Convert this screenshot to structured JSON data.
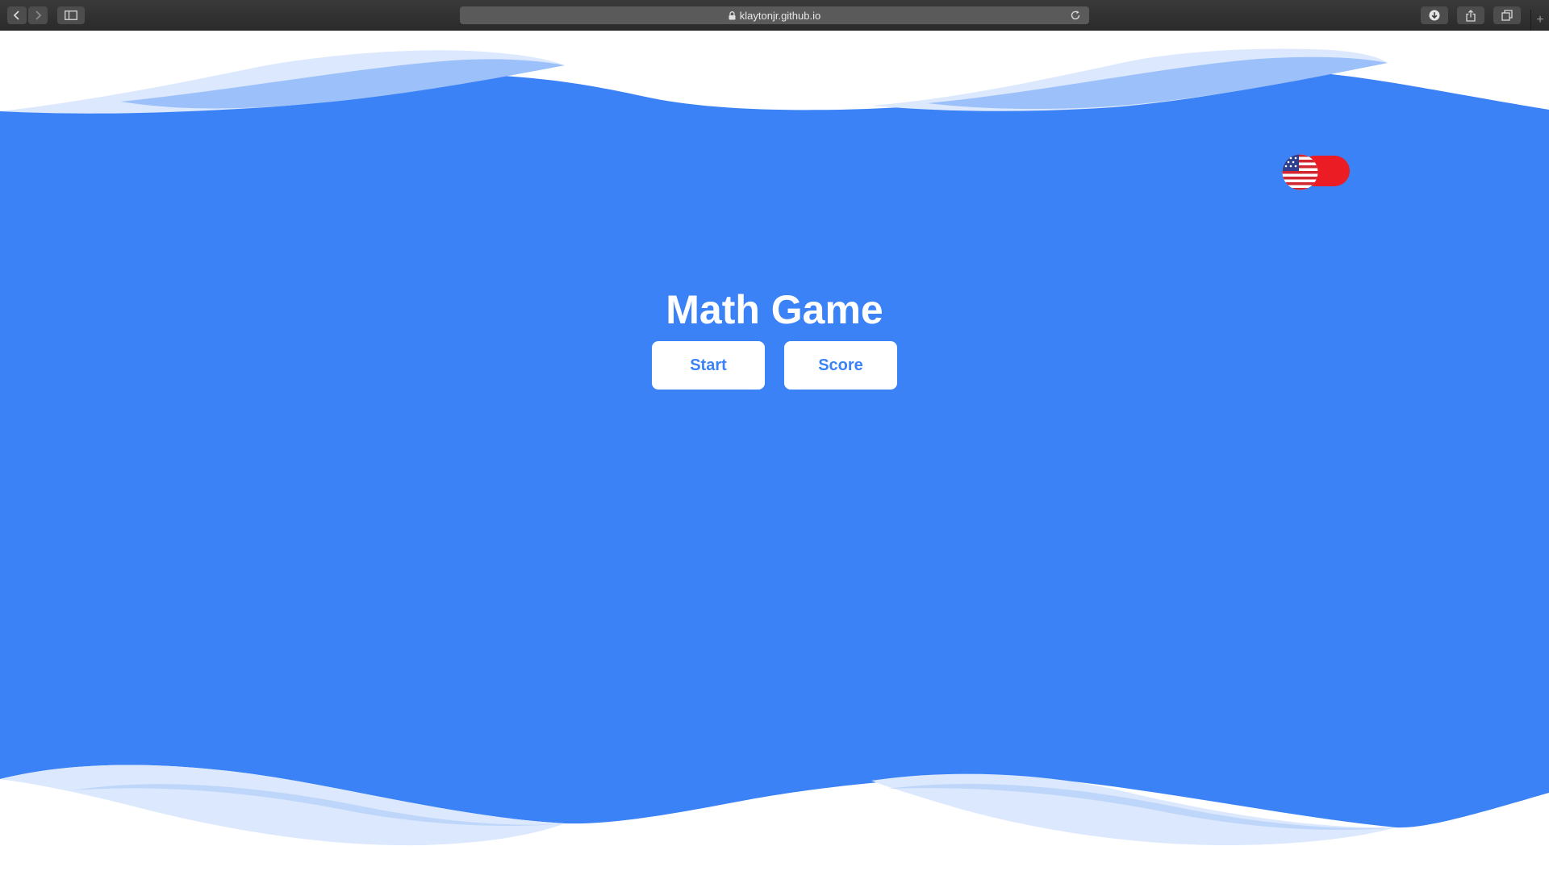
{
  "browser": {
    "url": "klaytonjr.github.io",
    "new_tab_symbol": "+",
    "icons": {
      "back": "chevron-left-icon",
      "forward": "chevron-right-icon",
      "sidebar": "sidebar-icon",
      "lock": "lock-icon",
      "reload": "reload-icon",
      "downloads": "download-icon",
      "share": "share-icon",
      "tabs": "tabs-overview-icon"
    }
  },
  "page": {
    "title": "Math Game",
    "buttons": {
      "start": "Start",
      "score": "Score"
    },
    "language_toggle": {
      "flag": "us-flag-icon",
      "track_color": "#ec1c24"
    },
    "colors": {
      "primary_blue": "#3b82f6",
      "light_wave": "#dbe8fd",
      "mid_wave": "#9cc0fa"
    }
  }
}
